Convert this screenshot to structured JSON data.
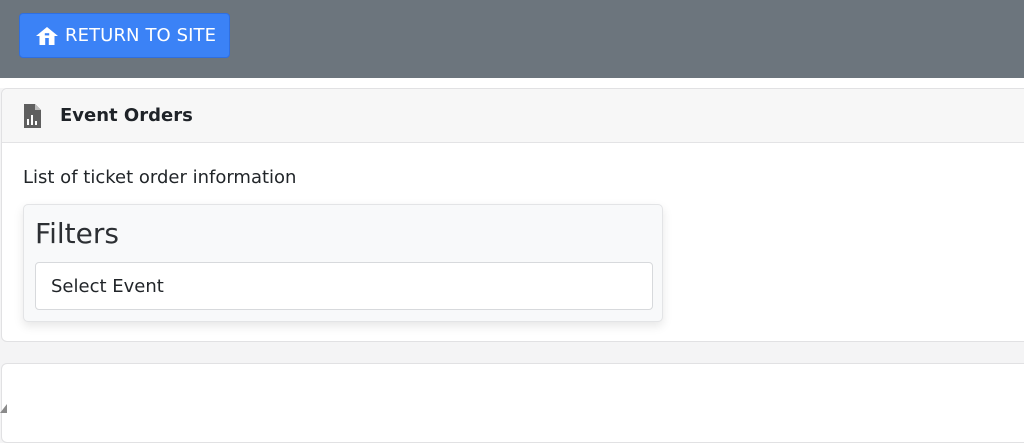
{
  "topbar": {
    "return_label": "RETURN TO SITE",
    "return_icon": "home-icon",
    "background": "#6c757d",
    "button_color": "#3b82f6"
  },
  "card": {
    "header_title": "Event Orders",
    "header_icon": "document-chart-icon",
    "description": "List of ticket order information"
  },
  "filters": {
    "title": "Filters",
    "select_event_label": "Select Event"
  }
}
